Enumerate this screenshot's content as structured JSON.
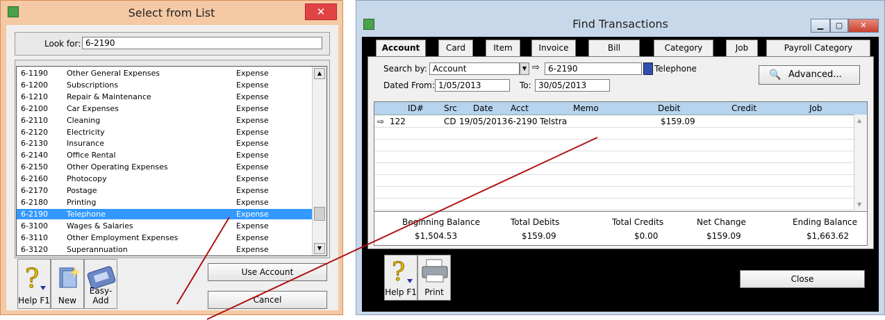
{
  "select_window": {
    "title": "Select from List",
    "close_glyph": "✕",
    "look_for_label": "Look for:",
    "look_for_value": "6-2190",
    "accounts": [
      {
        "code": "6-1190",
        "name": "Other General Expenses",
        "type": "Expense"
      },
      {
        "code": "6-1200",
        "name": "Subscriptions",
        "type": "Expense"
      },
      {
        "code": "6-1210",
        "name": "Repair & Maintenance",
        "type": "Expense"
      },
      {
        "code": "6-2100",
        "name": "Car Expenses",
        "type": "Expense"
      },
      {
        "code": "6-2110",
        "name": "Cleaning",
        "type": "Expense"
      },
      {
        "code": "6-2120",
        "name": "Electricity",
        "type": "Expense"
      },
      {
        "code": "6-2130",
        "name": "Insurance",
        "type": "Expense"
      },
      {
        "code": "6-2140",
        "name": "Office Rental",
        "type": "Expense"
      },
      {
        "code": "6-2150",
        "name": "Other Operating Expenses",
        "type": "Expense"
      },
      {
        "code": "6-2160",
        "name": "Photocopy",
        "type": "Expense"
      },
      {
        "code": "6-2170",
        "name": "Postage",
        "type": "Expense"
      },
      {
        "code": "6-2180",
        "name": "Printing",
        "type": "Expense"
      },
      {
        "code": "6-2190",
        "name": "Telephone",
        "type": "Expense"
      },
      {
        "code": "6-3100",
        "name": "Wages & Salaries",
        "type": "Expense"
      },
      {
        "code": "6-3110",
        "name": "Other Employment Expenses",
        "type": "Expense"
      },
      {
        "code": "6-3120",
        "name": "Superannuation",
        "type": "Expense"
      }
    ],
    "selected_code": "6-2190",
    "toolbar": {
      "help": "Help F1",
      "new": "New",
      "easy_add": "Easy-Add"
    },
    "use_account_button": "Use Account",
    "cancel_button": "Cancel"
  },
  "find_window": {
    "title": "Find Transactions",
    "tabs": [
      "Account",
      "Card",
      "Item",
      "Invoice",
      "Bill",
      "Category",
      "Job",
      "Payroll Category"
    ],
    "active_tab": "Account",
    "search_by_label": "Search by:",
    "search_by_value": "Account",
    "account_value": "6-2190",
    "account_name": "Telephone",
    "advanced_button": "Advanced...",
    "dated_from_label": "Dated From:",
    "dated_from_value": "1/05/2013",
    "to_label": "To:",
    "to_value": "30/05/2013",
    "columns": [
      "ID#",
      "Src",
      "Date",
      "Acct",
      "Memo",
      "Debit",
      "Credit",
      "Job"
    ],
    "rows": [
      {
        "id": "122",
        "src": "CD",
        "date": "19/05/2013",
        "acct": "6-2190",
        "memo": "Telstra",
        "debit": "$159.09",
        "credit": "",
        "job": ""
      }
    ],
    "totals_labels": [
      "Beginning Balance",
      "Total Debits",
      "Total Credits",
      "Net Change",
      "Ending Balance"
    ],
    "totals_values": [
      "$1,504.53",
      "$159.09",
      "$0.00",
      "$159.09",
      "$1,663.62"
    ],
    "toolbar": {
      "help": "Help F1",
      "print": "Print"
    },
    "close_button": "Close"
  },
  "colors": {
    "selection": "#3399ff",
    "annotation": "#b01010"
  }
}
